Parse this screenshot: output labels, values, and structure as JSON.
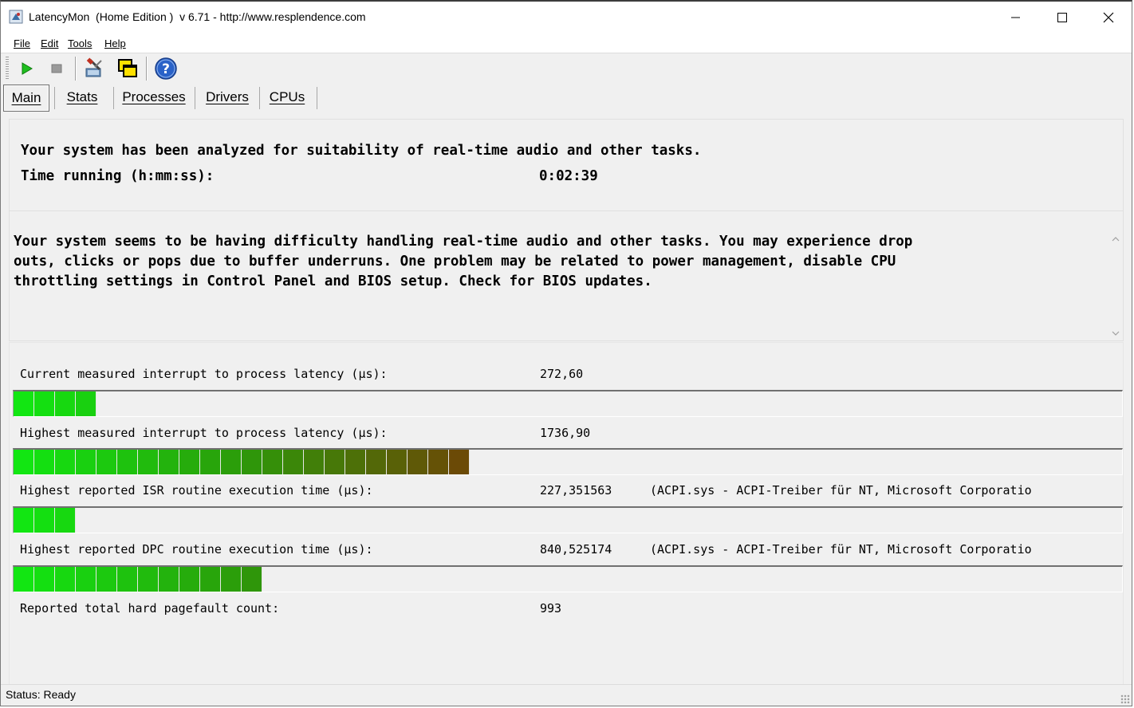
{
  "window": {
    "title": "LatencyMon  (Home Edition )  v 6.71 - http://www.resplendence.com",
    "minimize_symbol": "—",
    "maximize_symbol": "☐",
    "close_symbol": "✕"
  },
  "menu": [
    "File",
    "Edit",
    "Tools",
    "Help"
  ],
  "toolbar": {
    "buttons": [
      "play-icon",
      "stop-icon",
      "settings-tools-icon",
      "window-copy-icon",
      "help-icon"
    ]
  },
  "tabs": [
    "Main",
    "Stats",
    "Processes",
    "Drivers",
    "CPUs"
  ],
  "active_tab": "Main",
  "summary": {
    "line1": "Your system has been analyzed for suitability of real-time audio and other tasks.",
    "time_label": "Time running (h:mm:ss):",
    "time_value": "0:02:39"
  },
  "message": "Your system seems to be having difficulty handling real-time audio and other tasks. You may experience drop\nouts, clicks or pops due to buffer underruns. One problem may be related to power management, disable CPU\nthrottling settings in Control Panel and BIOS setup. Check for BIOS updates.",
  "stats": [
    {
      "label": "Current measured interrupt to process latency (µs):",
      "value": "272,60",
      "extra": "",
      "bar_segments": 4
    },
    {
      "label": "Highest measured interrupt to process latency (µs):",
      "value": "1736,90",
      "extra": "",
      "bar_segments": 22
    },
    {
      "label": "Highest reported ISR routine execution time (µs):",
      "value": "227,351563",
      "extra": "(ACPI.sys - ACPI-Treiber für NT, Microsoft Corporatio",
      "bar_segments": 3
    },
    {
      "label": "Highest reported DPC routine execution time (µs):",
      "value": "840,525174",
      "extra": "(ACPI.sys - ACPI-Treiber für NT, Microsoft Corporatio",
      "bar_segments": 12
    },
    {
      "label": "Reported total hard pagefault count:",
      "value": "993",
      "extra": "",
      "bar_segments": null
    }
  ],
  "colors": {
    "bar_start": "#12e612",
    "bar_mid": "#2c9a0a",
    "bar_end": "#6b4a06"
  },
  "status": "Status: Ready"
}
